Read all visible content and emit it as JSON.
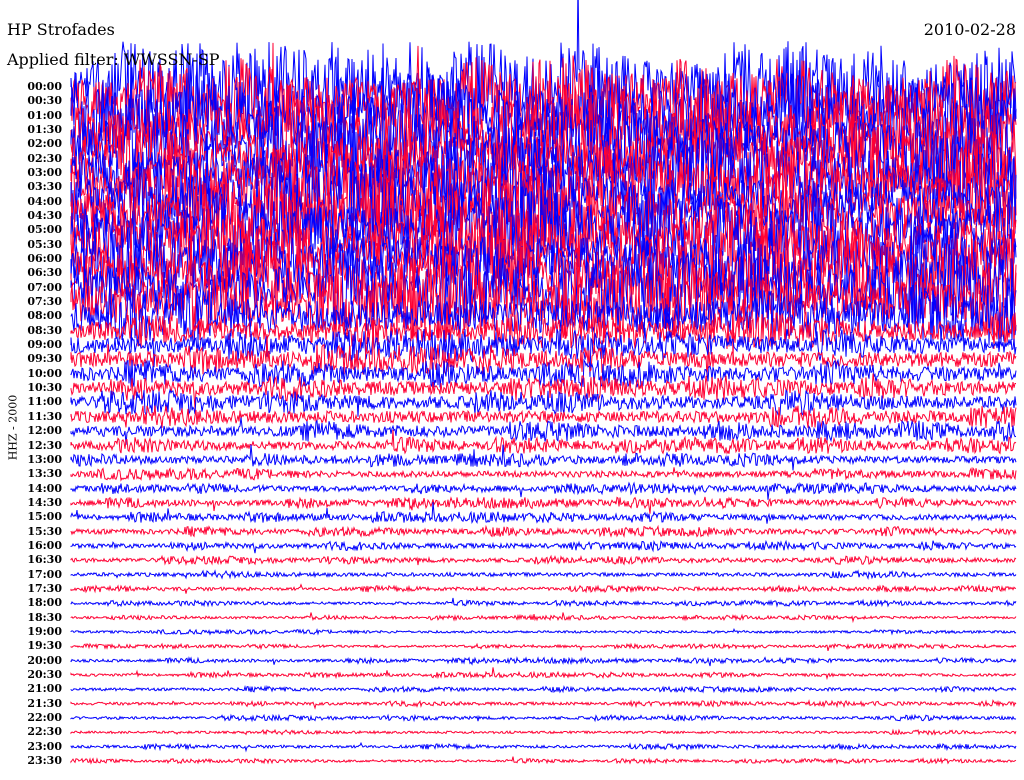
{
  "header": {
    "station": "HP Strofades",
    "filter": "Applied filter: WWSSN-SP",
    "date": "2010-02-28"
  },
  "chart_data": {
    "type": "line",
    "title": "HP Strofades",
    "subtitle": "Applied filter: WWSSN-SP",
    "date": "2010-02-28",
    "ylabel": "HHZ - 2000",
    "xlabel": "",
    "colors": {
      "even": "#0000ff",
      "odd": "#ff0033"
    },
    "rows": [
      {
        "label": "00:00",
        "amplitude": 1.0
      },
      {
        "label": "00:30",
        "amplitude": 1.0
      },
      {
        "label": "01:00",
        "amplitude": 1.0
      },
      {
        "label": "01:30",
        "amplitude": 1.0
      },
      {
        "label": "02:00",
        "amplitude": 1.0
      },
      {
        "label": "02:30",
        "amplitude": 1.0
      },
      {
        "label": "03:00",
        "amplitude": 1.0
      },
      {
        "label": "03:30",
        "amplitude": 1.0
      },
      {
        "label": "04:00",
        "amplitude": 1.0
      },
      {
        "label": "04:30",
        "amplitude": 1.0
      },
      {
        "label": "05:00",
        "amplitude": 1.0
      },
      {
        "label": "05:30",
        "amplitude": 1.0
      },
      {
        "label": "06:00",
        "amplitude": 1.0
      },
      {
        "label": "06:30",
        "amplitude": 1.0
      },
      {
        "label": "07:00",
        "amplitude": 0.95
      },
      {
        "label": "07:30",
        "amplitude": 0.9
      },
      {
        "label": "08:00",
        "amplitude": 0.7
      },
      {
        "label": "08:30",
        "amplitude": 0.4
      },
      {
        "label": "09:00",
        "amplitude": 0.35
      },
      {
        "label": "09:30",
        "amplitude": 0.33
      },
      {
        "label": "10:00",
        "amplitude": 0.3
      },
      {
        "label": "10:30",
        "amplitude": 0.28
      },
      {
        "label": "11:00",
        "amplitude": 0.27
      },
      {
        "label": "11:30",
        "amplitude": 0.25
      },
      {
        "label": "12:00",
        "amplitude": 0.23
      },
      {
        "label": "12:30",
        "amplitude": 0.18
      },
      {
        "label": "13:00",
        "amplitude": 0.15
      },
      {
        "label": "13:30",
        "amplitude": 0.13
      },
      {
        "label": "14:00",
        "amplitude": 0.12
      },
      {
        "label": "14:30",
        "amplitude": 0.12
      },
      {
        "label": "15:00",
        "amplitude": 0.12
      },
      {
        "label": "15:30",
        "amplitude": 0.11
      },
      {
        "label": "16:00",
        "amplitude": 0.1
      },
      {
        "label": "16:30",
        "amplitude": 0.09
      },
      {
        "label": "17:00",
        "amplitude": 0.08
      },
      {
        "label": "17:30",
        "amplitude": 0.07
      },
      {
        "label": "18:00",
        "amplitude": 0.06
      },
      {
        "label": "18:30",
        "amplitude": 0.05
      },
      {
        "label": "19:00",
        "amplitude": 0.05
      },
      {
        "label": "19:30",
        "amplitude": 0.05
      },
      {
        "label": "20:00",
        "amplitude": 0.06
      },
      {
        "label": "20:30",
        "amplitude": 0.06
      },
      {
        "label": "21:00",
        "amplitude": 0.06
      },
      {
        "label": "21:30",
        "amplitude": 0.06
      },
      {
        "label": "22:00",
        "amplitude": 0.06
      },
      {
        "label": "22:30",
        "amplitude": 0.05
      },
      {
        "label": "23:00",
        "amplitude": 0.06
      },
      {
        "label": "23:30",
        "amplitude": 0.05
      }
    ]
  }
}
